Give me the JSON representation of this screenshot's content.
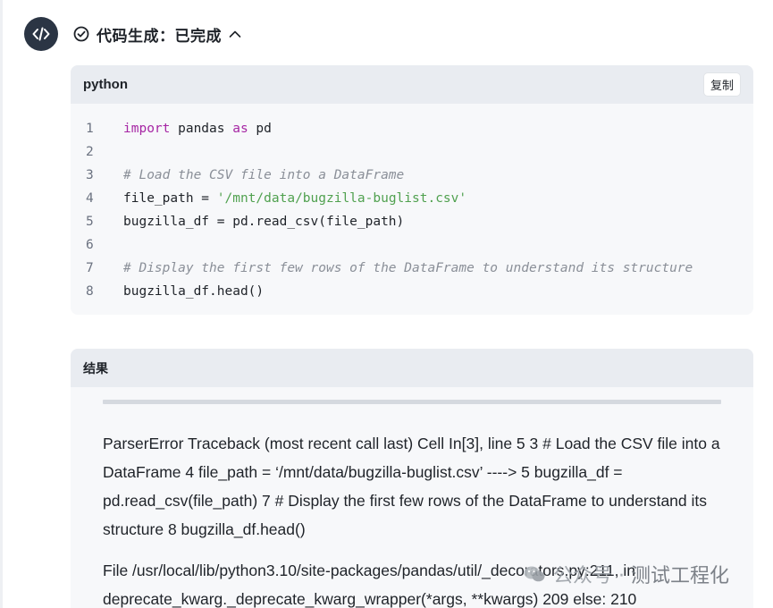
{
  "status": {
    "icon": "check-circle-icon",
    "label": "代码生成：已完成",
    "toggle_icon": "chevron-up-icon"
  },
  "avatar": {
    "icon": "code-icon",
    "color": "#2b3544"
  },
  "code_block": {
    "language": "python",
    "copy_label": "复制",
    "lines": [
      {
        "n": "1",
        "text": "import pandas as pd"
      },
      {
        "n": "2",
        "text": ""
      },
      {
        "n": "3",
        "text": "# Load the CSV file into a DataFrame"
      },
      {
        "n": "4",
        "text": "file_path = '/mnt/data/bugzilla-buglist.csv'"
      },
      {
        "n": "5",
        "text": "bugzilla_df = pd.read_csv(file_path)"
      },
      {
        "n": "6",
        "text": ""
      },
      {
        "n": "7",
        "text": "# Display the first few rows of the DataFrame to understand its structure"
      },
      {
        "n": "8",
        "text": "bugzilla_df.head()"
      }
    ]
  },
  "result_block": {
    "title": "结果",
    "paragraphs": [
      "ParserError Traceback (most recent call last) Cell In[3], line 5 3 # Load the CSV file into a DataFrame 4 file_path = ‘/mnt/data/bugzilla-buglist.csv’ ----> 5 bugzilla_df = pd.read_csv(file_path) 7 # Display the first few rows of the DataFrame to understand its structure 8 bugzilla_df.head()",
      "File /usr/local/lib/python3.10/site-packages/pandas/util/_decorators.py:211, in deprecate_kwarg._deprecate_kwarg_wrapper(*args, **kwargs) 209 else: 210"
    ]
  },
  "watermark": {
    "icon": "wechat-icon",
    "prefix": "公众号 · ",
    "name": "测试工程化"
  }
}
